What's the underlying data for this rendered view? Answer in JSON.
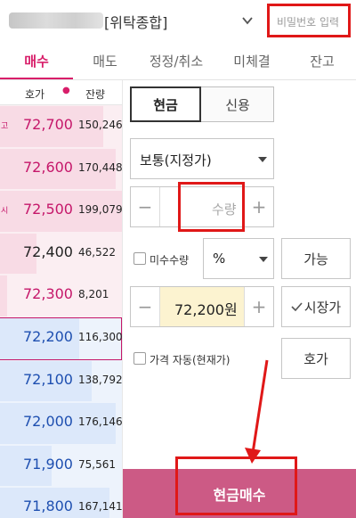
{
  "header": {
    "account_name": "[위탁종합]",
    "password_placeholder": "비밀번호 입력"
  },
  "tabs": [
    {
      "label": "매수",
      "active": true
    },
    {
      "label": "매도"
    },
    {
      "label": "정정/취소"
    },
    {
      "label": "미체결"
    },
    {
      "label": "잔고"
    }
  ],
  "orderbook": {
    "col_price": "호가",
    "col_qty": "잔량",
    "rows": [
      {
        "mark": "고",
        "price": "72,700",
        "qty": "150,246",
        "side": "ask",
        "bar": 0.85
      },
      {
        "mark": "",
        "price": "72,600",
        "qty": "170,448",
        "side": "ask",
        "bar": 0.95
      },
      {
        "mark": "시",
        "price": "72,500",
        "qty": "199,079",
        "side": "ask",
        "bar": 1.0
      },
      {
        "mark": "",
        "price": "72,400",
        "qty": "46,522",
        "side": "ask",
        "ref": true,
        "bar": 0.3
      },
      {
        "mark": "",
        "price": "72,300",
        "qty": "8,201",
        "side": "ask",
        "bar": 0.06
      },
      {
        "mark": "",
        "price": "72,200",
        "qty": "116,300",
        "side": "bid",
        "current": true,
        "bar": 0.65
      },
      {
        "mark": "",
        "price": "72,100",
        "qty": "138,792",
        "side": "bid",
        "bar": 0.75
      },
      {
        "mark": "",
        "price": "72,000",
        "qty": "176,146",
        "side": "bid",
        "bar": 0.95
      },
      {
        "mark": "",
        "price": "71,900",
        "qty": "75,561",
        "side": "bid",
        "bar": 0.42
      },
      {
        "mark": "",
        "price": "71,800",
        "qty": "167,141",
        "side": "bid",
        "bar": 0.9
      }
    ]
  },
  "order": {
    "type_cash": "현금",
    "type_credit": "신용",
    "order_kind": "보통(지정가)",
    "qty_placeholder": "수량",
    "minus": "−",
    "plus": "+",
    "odd_lot_label": "미수수량",
    "pct_select": "%",
    "available_label": "가능",
    "price_value": "72,200원",
    "market_price_label": "시장가",
    "auto_price_label": "가격 자동(현재가)",
    "hoga_label": "호가",
    "submit_label": "현금매수"
  },
  "colors": {
    "accent": "#d81e6a",
    "ask_price": "#c5176a",
    "bid_price": "#1e4fb0",
    "submit_bg": "#cc5a85",
    "highlight": "#e01818"
  }
}
